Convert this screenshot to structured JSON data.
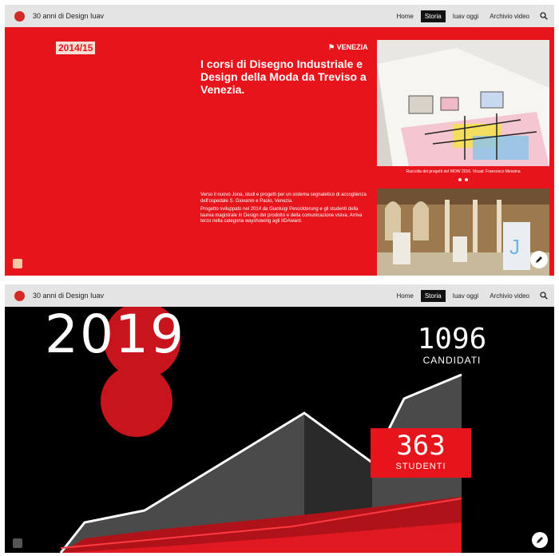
{
  "site": {
    "title": "30 anni di Design Iuav",
    "nav": [
      "Home",
      "Storia",
      "Iuav oggi",
      "Archivio video"
    ],
    "active_nav": "Storia"
  },
  "slide_1": {
    "year": "2014/15",
    "location": "VENEZIA",
    "headline": "I corsi di Disegno Industriale e Design della Moda da Treviso a Venezia.",
    "paragraph_1": "Verso il nuovo Jona, studi e progetti per un sistema segnaletico di accoglienza dell'ospedale S. Giovanni e Paolo, Venezia.",
    "paragraph_2": "Progetto sviluppato nel 2014 da Gianluigi Pescolderung e gli studenti della laurea magistrale in Design del prodotto e della comunicazione visiva. Arriva terzo nella categoria wayshowing agli IIDAward.",
    "photo_caption": "Raccolta dei progetti del WDW 2016. Visual: Francesco Messina",
    "carousel_dots": 2
  },
  "slide_2": {
    "year": "2019",
    "candidates_value": "1096",
    "candidates_label": "CANDIDATI",
    "students_value": "363",
    "students_label": "STUDENTI"
  },
  "colors": {
    "brand_red": "#e8141c",
    "topbar": "#e4e4e4",
    "dark_bg": "#000000"
  },
  "icons": [
    "search-icon",
    "pencil-icon",
    "menu-square-icon",
    "site-logo"
  ]
}
